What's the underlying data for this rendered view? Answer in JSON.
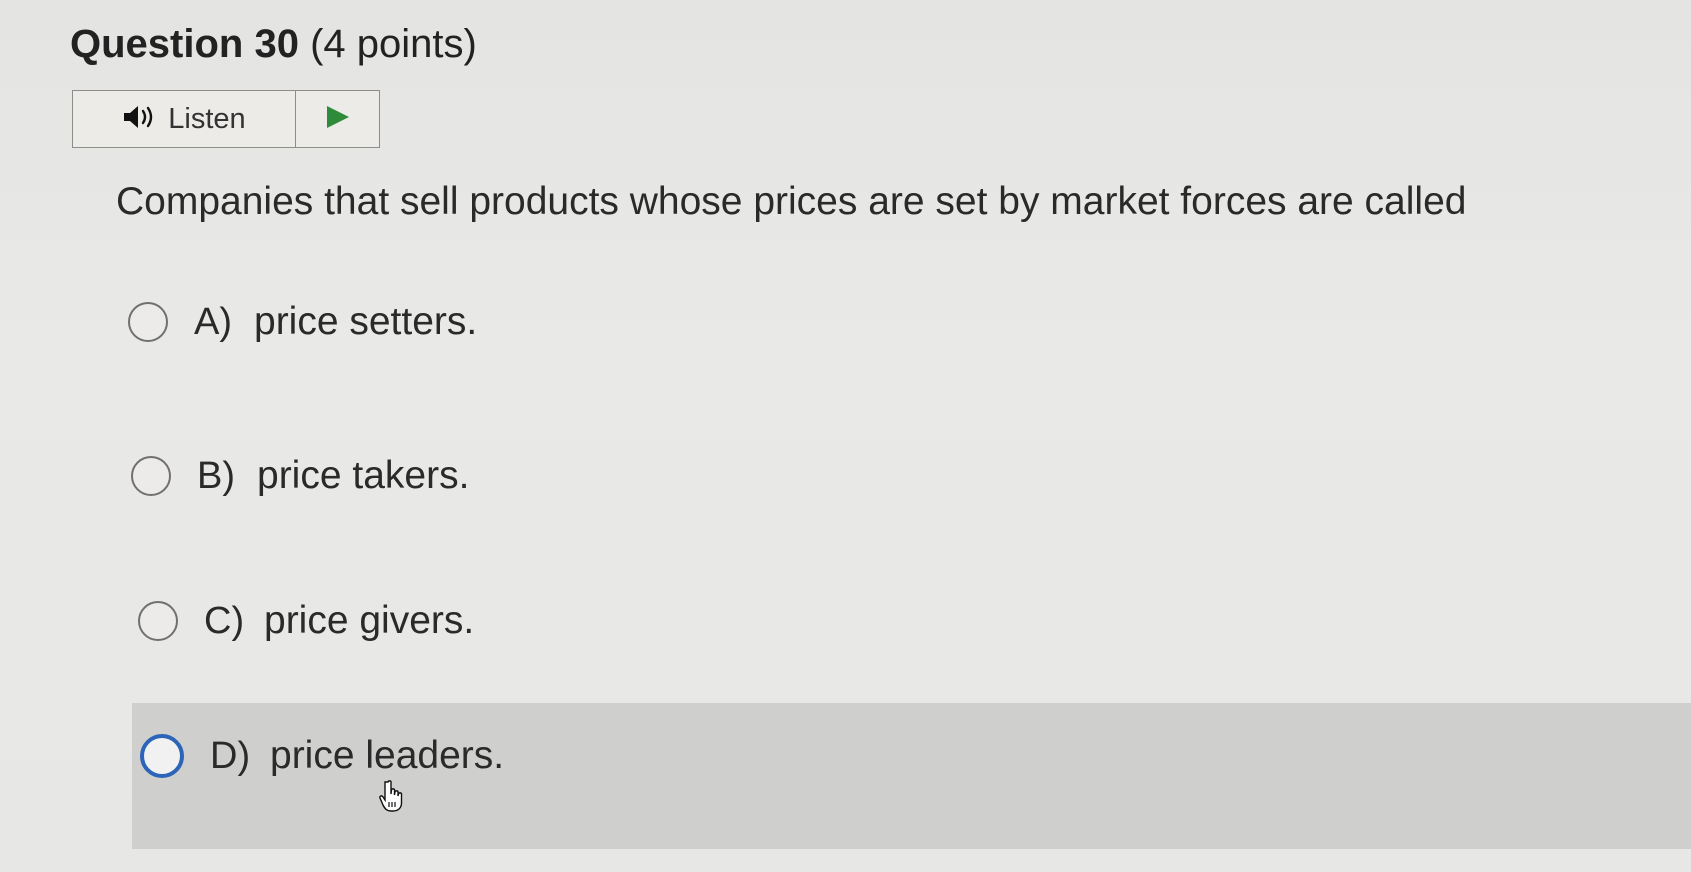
{
  "question": {
    "number_label": "Question 30",
    "points_label": "(4 points)",
    "text": "Companies that sell products whose prices are set by market forces are called"
  },
  "listen": {
    "label": "Listen",
    "icon": "speaker-icon",
    "play_icon": "play-icon",
    "accent_color": "#2e8b3a"
  },
  "options": [
    {
      "letter": "A)",
      "text": "price setters.",
      "selected": false
    },
    {
      "letter": "B)",
      "text": "price takers.",
      "selected": false
    },
    {
      "letter": "C)",
      "text": "price givers.",
      "selected": false
    },
    {
      "letter": "D)",
      "text": "price leaders.",
      "selected": false,
      "hovered": true
    }
  ],
  "colors": {
    "focus_ring": "#2b64b8",
    "hover_background": "#cfcfcd"
  },
  "cursor": "hand-pointer-icon"
}
